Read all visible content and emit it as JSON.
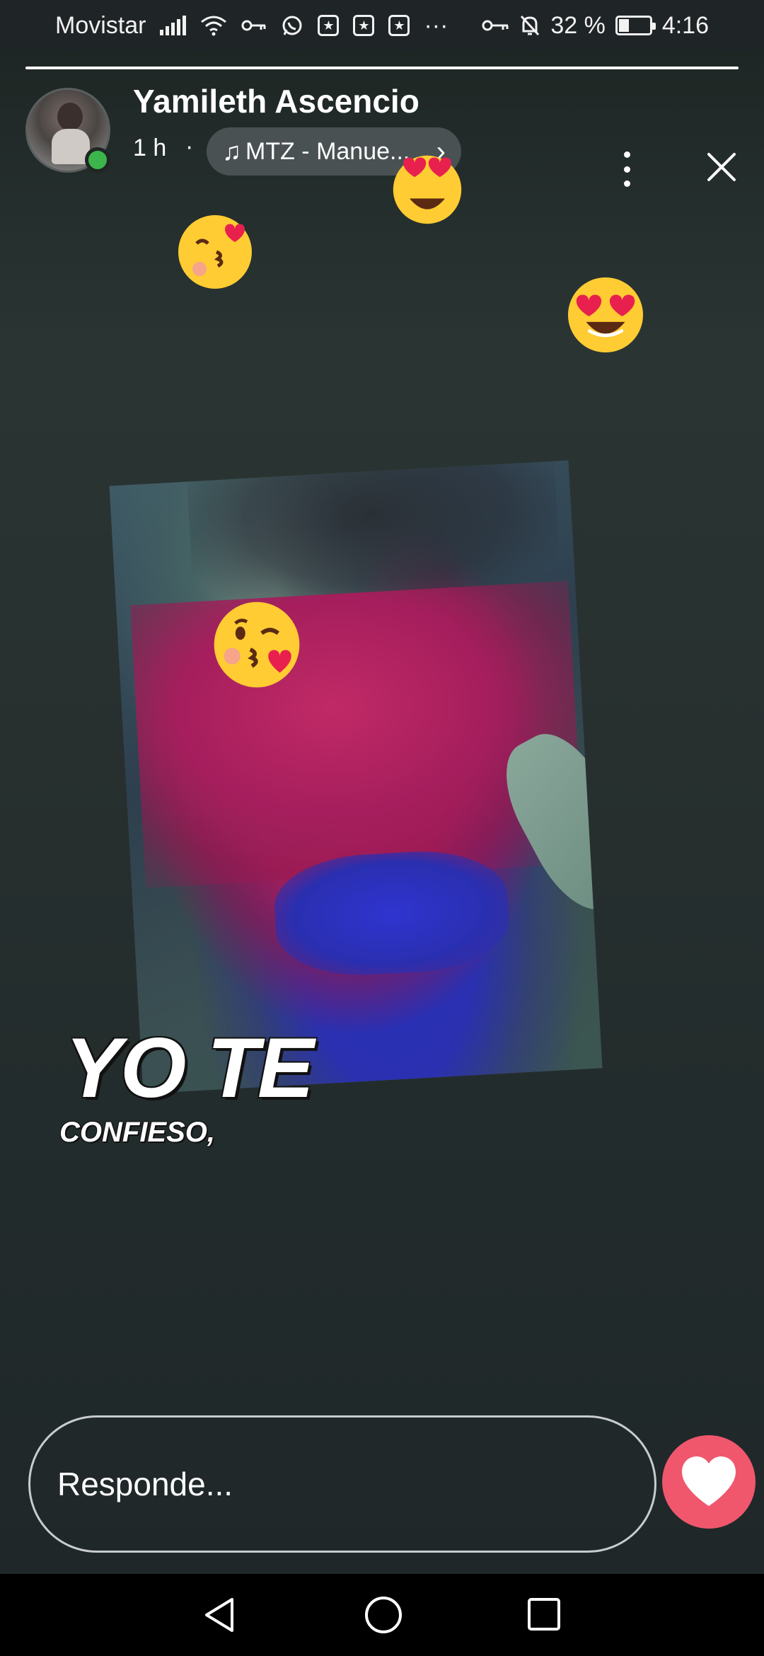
{
  "status_bar": {
    "carrier": "Movistar",
    "battery": "32 %",
    "battery_level": 0.32,
    "time": "4:16",
    "more": "···"
  },
  "story": {
    "progress": 1.0,
    "author": "Yamileth Ascencio",
    "time": "1 h",
    "separator": "·",
    "music_label": "MTZ - Manue...",
    "caption_line1": "YO TE",
    "caption_line2": "CONFIESO,"
  },
  "reply": {
    "placeholder": "Responde..."
  },
  "icons": {
    "music": "music-note-icon",
    "more": "more-vertical-icon",
    "close": "close-icon",
    "like": "heart-icon",
    "nav_back": "back-triangle-icon",
    "nav_home": "home-circle-icon",
    "nav_recent": "recent-square-icon"
  },
  "colors": {
    "online": "#3cb54a",
    "like_button": "#f0576d",
    "status_bar": "#1f2426"
  }
}
